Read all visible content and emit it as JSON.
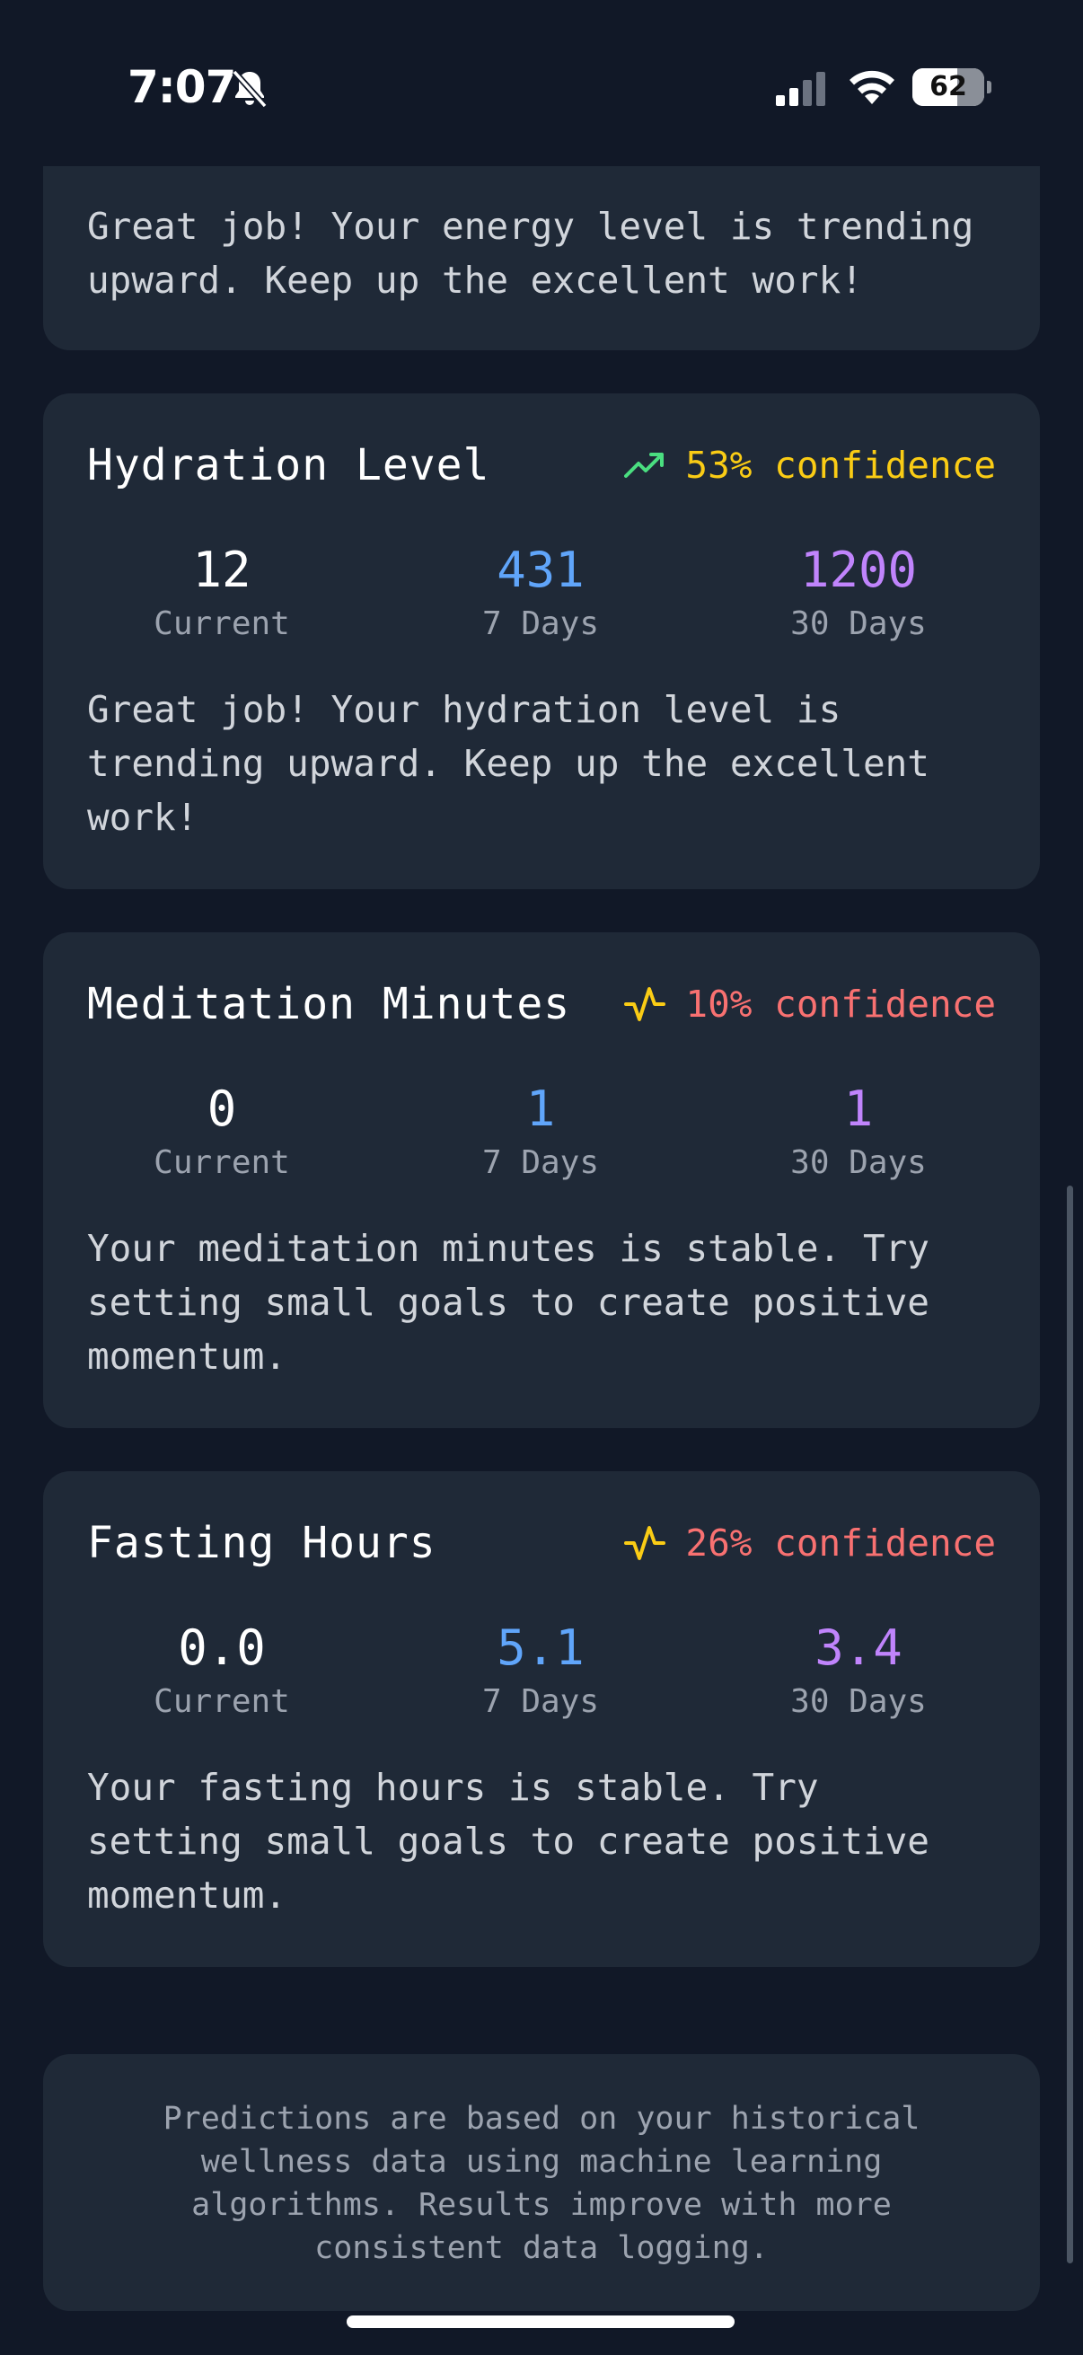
{
  "status_bar": {
    "time": "7:07",
    "battery": "62",
    "battery_level": 0.62
  },
  "energy_card": {
    "message": "Great job! Your energy level is trending\nupward. Keep up the excellent work!"
  },
  "metrics": [
    {
      "title": "Hydration Level",
      "trend_icon": "trending-up-icon",
      "confidence": "53% confidence",
      "confidence_color": "#facc15",
      "current": "12",
      "current_label": "Current",
      "week": "431",
      "week_label": "7 Days",
      "month": "1200",
      "month_label": "30 Days",
      "message": "Great job! Your hydration level is\ntrending upward. Keep up the excellent\nwork!"
    },
    {
      "title": "Meditation Minutes",
      "trend_icon": "activity-icon",
      "confidence": "10% confidence",
      "confidence_color": "#f87171",
      "current": "0",
      "current_label": "Current",
      "week": "1",
      "week_label": "7 Days",
      "month": "1",
      "month_label": "30 Days",
      "message": "Your meditation minutes is stable. Try\nsetting small goals to create positive\nmomentum."
    },
    {
      "title": "Fasting Hours",
      "trend_icon": "activity-icon",
      "confidence": "26% confidence",
      "confidence_color": "#f87171",
      "current": "0.0",
      "current_label": "Current",
      "week": "5.1",
      "week_label": "7 Days",
      "month": "3.4",
      "month_label": "30 Days",
      "message": "Your fasting hours is stable. Try\nsetting small goals to create positive\nmomentum."
    }
  ],
  "footer": {
    "note": "Predictions are based on your historical wellness data using machine learning algorithms. Results improve with more consistent data logging."
  },
  "colors": {
    "background": "#111827",
    "card": "#1f2937",
    "trend_up": "#4ade80",
    "activity_icon": "#facc15",
    "week_value": "#60a5fa",
    "month_value": "#c084fc"
  }
}
